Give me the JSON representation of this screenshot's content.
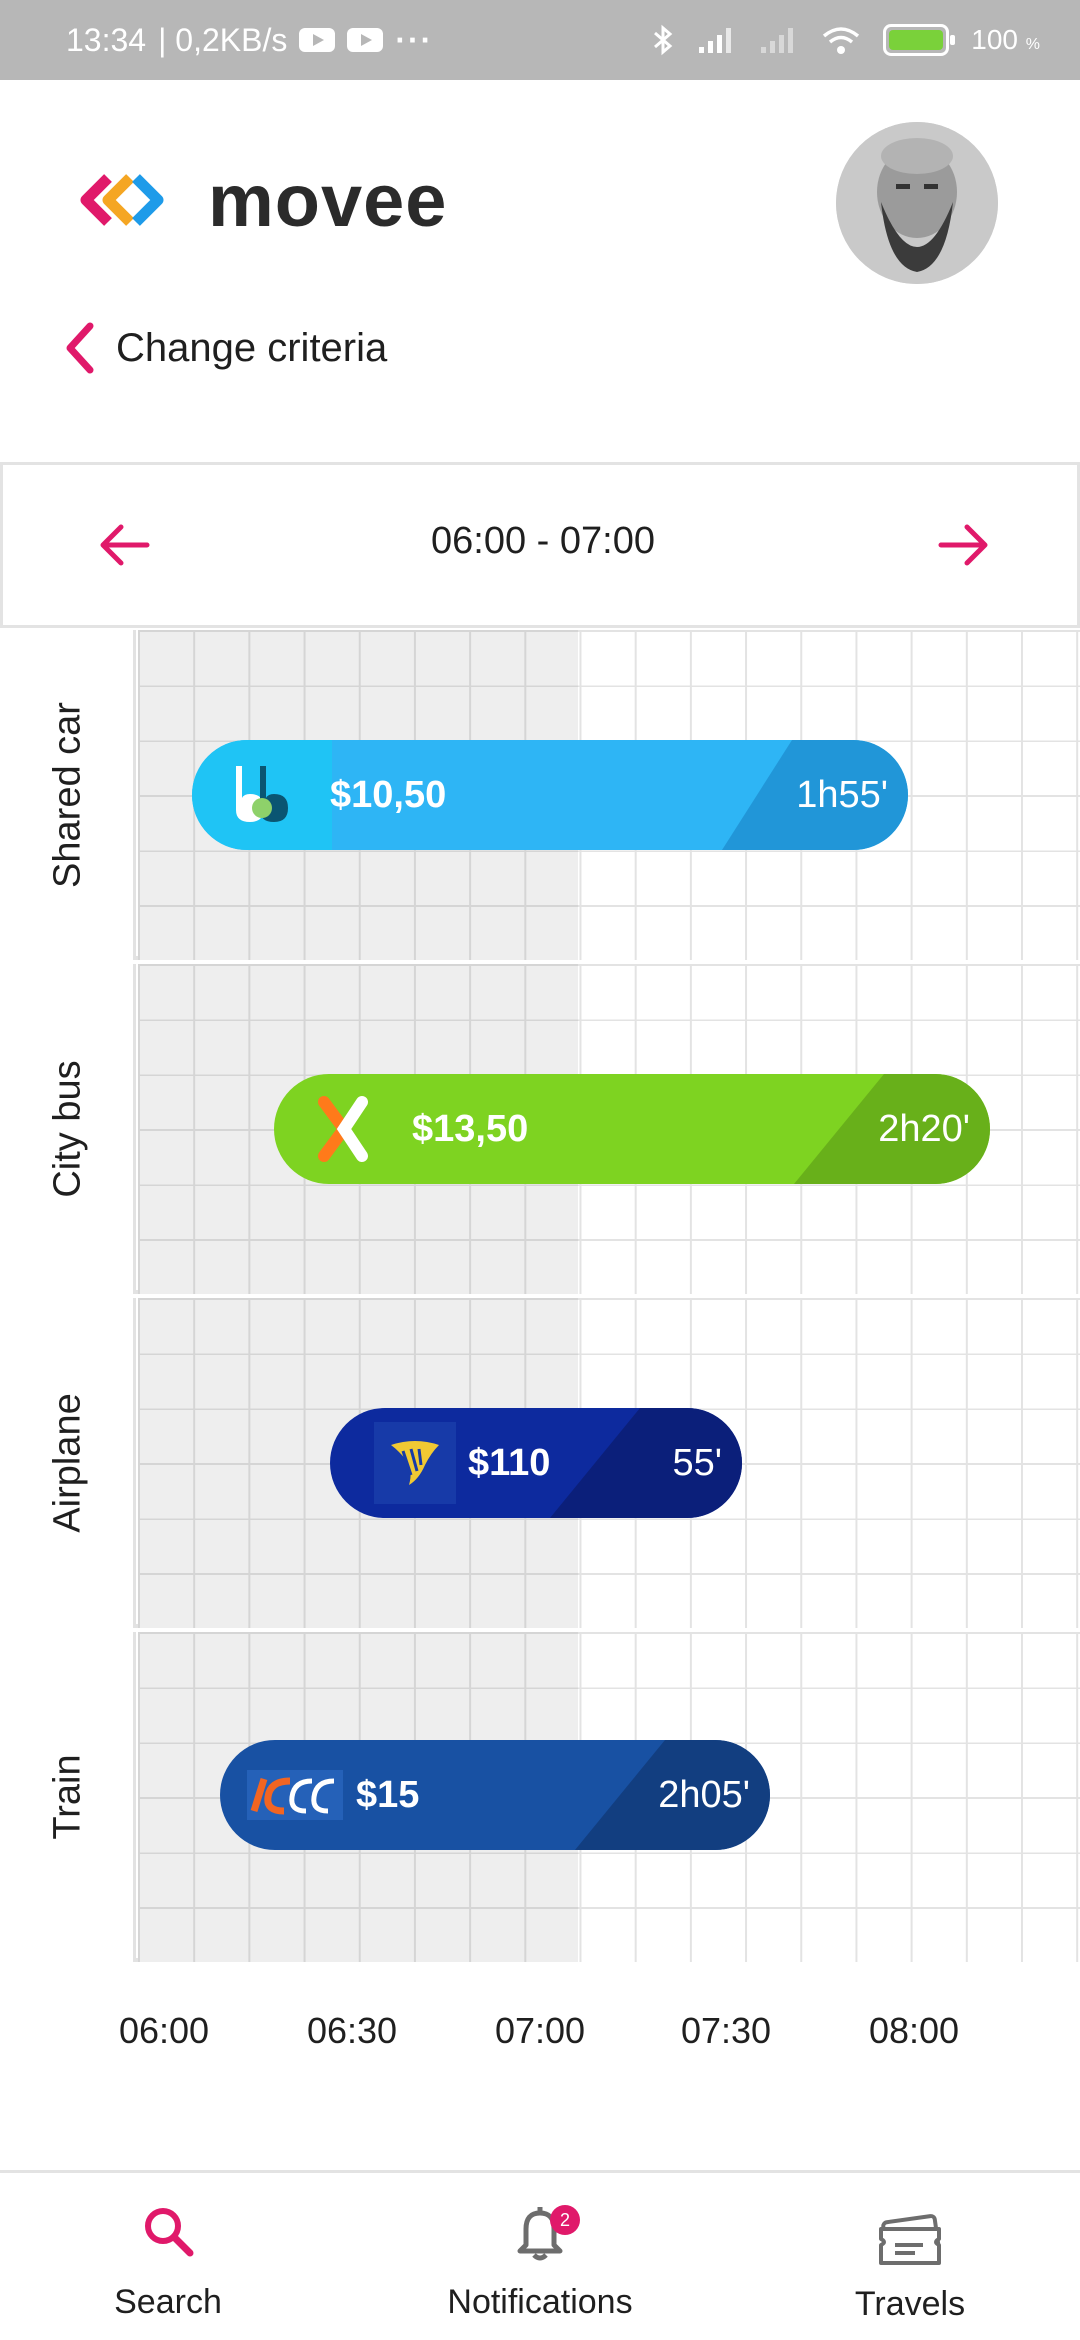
{
  "status_bar": {
    "time": "13:34",
    "network_speed": "| 0,2KB/s",
    "more": "···",
    "battery": "100",
    "battery_unit": "%"
  },
  "header": {
    "brand": "movee",
    "brand_colors": [
      "#e0196a",
      "#f5a623",
      "#1e9be9"
    ]
  },
  "back_link": {
    "label": "Change criteria"
  },
  "time_range": {
    "label": "06:00 - 07:00"
  },
  "transport_rows": [
    {
      "label": "Shared car",
      "price": "$10,50",
      "duration": "1h55'",
      "color": "#2eb5f5",
      "icon": "blablacar-logo"
    },
    {
      "label": "City bus",
      "price": "$13,50",
      "duration": "2h20'",
      "color": "#7ed321",
      "icon": "flixbus-logo"
    },
    {
      "label": "Airplane",
      "price": "$110",
      "duration": "55'",
      "color": "#0d2a9e",
      "icon": "ryanair-logo"
    },
    {
      "label": "Train",
      "price": "$15",
      "duration": "2h05'",
      "color": "#1851a3",
      "icon": "intercity-logo"
    }
  ],
  "time_axis": [
    "06:00",
    "06:30",
    "07:00",
    "07:30",
    "08:00"
  ],
  "bottom_nav": {
    "items": [
      {
        "label": "Search",
        "active": true,
        "icon": "search-icon"
      },
      {
        "label": "Notifications",
        "badge": "2",
        "icon": "bell-icon"
      },
      {
        "label": "Travels",
        "icon": "ticket-icon"
      }
    ]
  },
  "colors": {
    "accent": "#e0196a",
    "grid_line": "#e3e3e3"
  }
}
